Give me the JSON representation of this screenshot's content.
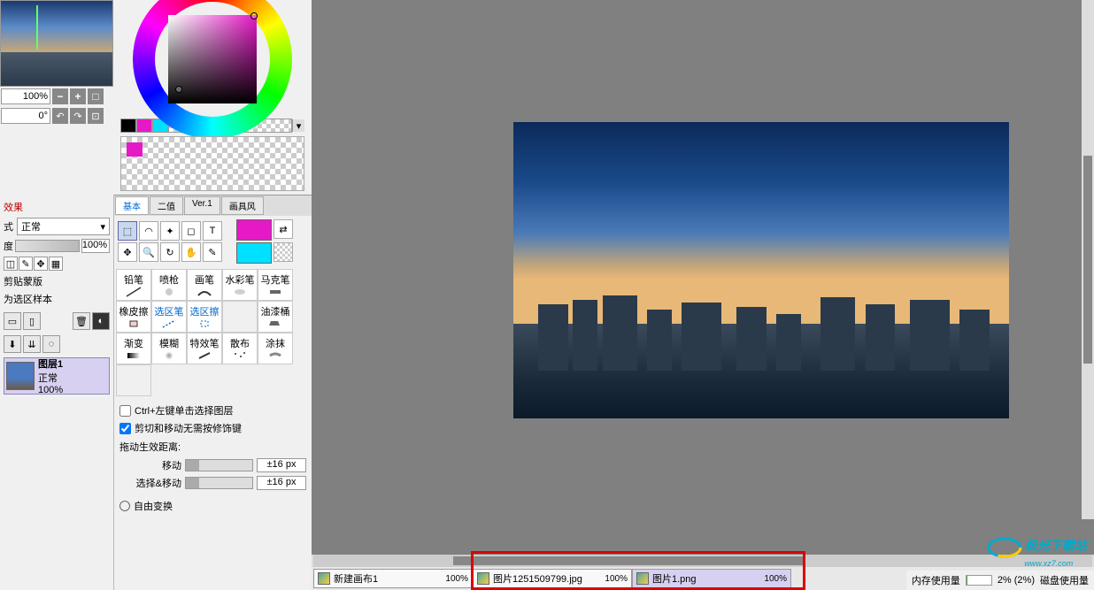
{
  "navigator": {
    "zoom": "100%",
    "rotation": "0°"
  },
  "color_panel": {
    "swatches": [
      "#000000",
      "#e619c7",
      "#00e0ff"
    ],
    "dropdown_arrow": "▾"
  },
  "layer_panel": {
    "section_label": "效果",
    "mode_label": "式",
    "blend_mode": "正常",
    "opacity_label": "度",
    "opacity_value": "100%",
    "clip_label": "剪贴蒙版",
    "sample_label": "为选区样本",
    "layer1": {
      "name": "图层1",
      "mode": "正常",
      "opacity": "100%"
    }
  },
  "tool_tabs": [
    "基本",
    "二值",
    "Ver.1",
    "画具风"
  ],
  "swatch_fg": "#e619c7",
  "swatch_bg": "#00e0ff",
  "brush_presets": [
    [
      "铅笔",
      "喷枪",
      "画笔",
      "水彩笔"
    ],
    [
      "马克笔",
      "橡皮擦",
      "选区笔",
      "选区擦"
    ],
    [
      "",
      "油漆桶",
      "渐变",
      "模糊"
    ],
    [
      "特效笔",
      "散布",
      "涂抹",
      ""
    ]
  ],
  "options": {
    "check1": "Ctrl+左键单击选择图层",
    "check2": "剪切和移动无需按修饰键",
    "drag_label": "拖动生效距离:",
    "move_label": "移动",
    "move_val": "±16 px",
    "select_move_label": "选择&移动",
    "select_move_val": "±16 px",
    "free_transform": "自由变换"
  },
  "documents": [
    {
      "name": "新建画布1",
      "zoom": "100%"
    },
    {
      "name": "图片1251509799.jpg",
      "zoom": "100%"
    },
    {
      "name": "图片1.png",
      "zoom": "100%"
    }
  ],
  "status": {
    "mem_label": "内存使用量",
    "mem_val": "2% (2%)",
    "disk_label": "磁盘使用量"
  },
  "watermark": "极光下载站",
  "watermark_url": "www.xz7.com"
}
